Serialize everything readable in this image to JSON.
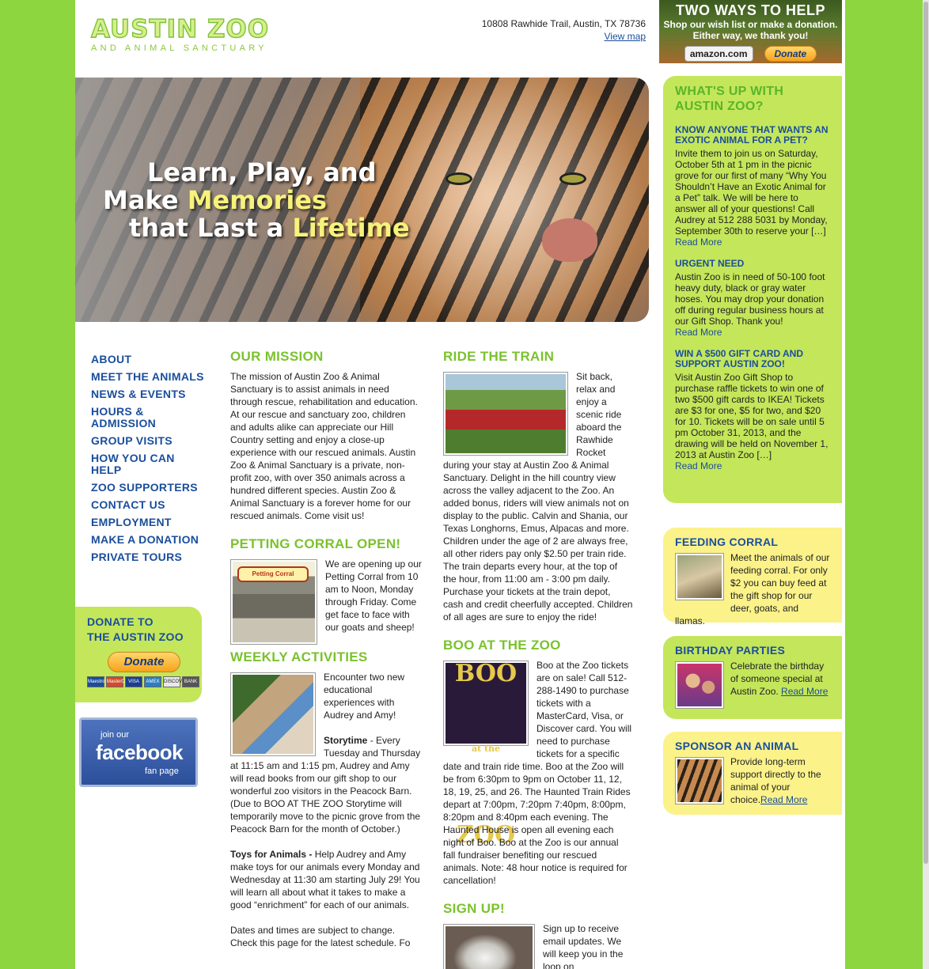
{
  "header": {
    "logo_name": "AUSTIN ZOO",
    "logo_sub": "AND ANIMAL SANCTUARY",
    "address": "10808 Rawhide Trail, Austin, TX 78736",
    "map_link": "View map"
  },
  "help": {
    "title": "TWO WAYS TO HELP",
    "sub1": "Shop our wish list or make a donation.",
    "sub2": "Either way, we thank you!",
    "amazon": "amazon.com",
    "donate": "Donate"
  },
  "hero": {
    "line1": "Learn, Play, and",
    "line2a": "Make ",
    "line2b": "Memories",
    "line3a": "that Last a ",
    "line3b": "Lifetime"
  },
  "nav": [
    "ABOUT",
    "MEET THE ANIMALS",
    "NEWS & EVENTS",
    "HOURS & ADMISSION",
    "GROUP VISITS",
    "HOW YOU CAN HELP",
    "ZOO SUPPORTERS",
    "CONTACT US",
    "EMPLOYMENT",
    "MAKE A DONATION",
    "PRIVATE TOURS"
  ],
  "donate_box": {
    "title1": "DONATE TO",
    "title2": "THE AUSTIN ZOO",
    "button": "Donate",
    "cards": [
      "Maestro",
      "MasterCard",
      "VISA",
      "AMEX",
      "DISCOVER",
      "BANK"
    ]
  },
  "facebook": {
    "join": "join our",
    "name": "facebook",
    "page": "fan page"
  },
  "mission": {
    "title": "OUR MISSION",
    "text": "The mission of Austin Zoo & Animal Sanctuary is to assist animals in need through rescue, rehabilitation and education. At our rescue and sanctuary zoo, children and adults alike can appreciate our Hill Country setting and enjoy a close-up experience with our rescued animals. Austin Zoo & Animal Sanctuary is a private, non-profit zoo, with over 350 animals across a hundred different species. Austin Zoo & Animal Sanctuary is a forever home for our rescued animals. Come visit us!"
  },
  "petting": {
    "title": "PETTING CORRAL OPEN!",
    "sign": "Petting Corral",
    "text": "We are opening up our Petting Corral from 10 am to Noon, Monday through Friday. Come get face to face with our goats and sheep!"
  },
  "weekly": {
    "title": "WEEKLY ACTIVITIES",
    "intro": "Encounter two new educational experiences with Audrey and Amy!",
    "story_label": "Storytime",
    "story_text": " - Every Tuesday and Thursday at 11:15 am and 1:15 pm, Audrey and Amy will read books from our gift shop to our wonderful zoo visitors in the Peacock Barn. (Due to BOO AT THE ZOO Storytime will temporarily move to the picnic grove from the Peacock Barn for the month of October.)",
    "toys_label": "Toys for Animals -",
    "toys_text": " Help Audrey and Amy make toys for our animals every Monday and Wednesday at 11:30 am starting July 29! You will learn all about what it takes to make a good “enrichment” for each of our animals.",
    "dates": "Dates and times are subject to change. Check this page for the latest schedule. Fo"
  },
  "train": {
    "title": "RIDE THE TRAIN",
    "text": "Sit back, relax and enjoy a scenic ride aboard the Rawhide Rocket during your stay at Austin Zoo & Animal Sanctuary. Delight in the hill country view across the valley adjacent to the Zoo. An added bonus, riders will view animals not on display to the public. Calvin and Shania, our Texas Longhorns, Emus, Alpacas and more. Children under the age of 2 are always free, all other riders pay only $2.50 per train ride. The train departs every hour, at the top of the hour, from 11:00 am - 3:00 pm daily. Purchase your tickets at the train depot, cash and credit cheerfully accepted. Children of all ages are sure to enjoy the ride!"
  },
  "boo": {
    "title": "BOO AT THE ZOO",
    "logo1": "BOO",
    "logo2": "at the",
    "logo3": "ZOO",
    "text": "Boo at the Zoo tickets are on sale! Call 512-288-1490 to purchase tickets with a MasterCard, Visa, or Discover card. You will need to purchase tickets for a specific date and train ride time. Boo at the Zoo will be from 6:30pm to 9pm on October 11, 12, 18, 19, 25, and 26. The Haunted Train Rides depart at 7:00pm, 7:20pm 7:40pm, 8:00pm, 8:20pm and 8:40pm each evening. The Haunted House is open all evening each night of Boo. Boo at the Zoo is our annual fall fundraiser benefiting our rescued animals. Note: 48 hour notice is required for cancellation!"
  },
  "signup": {
    "title": "SIGN UP!",
    "text": "Sign up to receive email updates. We will keep you in the loop on"
  },
  "whatsup": {
    "title": "WHAT'S UP WITH AUSTIN ZOO?",
    "items": [
      {
        "heading": "KNOW ANYONE THAT WANTS AN EXOTIC ANIMAL FOR A PET?",
        "text": "Invite them to join us on Saturday, October 5th at 1 pm in the picnic grove for our first of many “Why You Shouldn’t Have an Exotic Animal for a Pet” talk. We will be here to answer all of your questions! Call Audrey at 512 288 5031 by Monday, September 30th to reserve your […]",
        "link": "Read More"
      },
      {
        "heading": "URGENT NEED",
        "text": "Austin Zoo is in need of 50-100 foot heavy duty, black or gray water hoses. You may drop your donation off during regular business hours at our Gift Shop. Thank you!",
        "link": "Read More"
      },
      {
        "heading": "WIN A $500 GIFT CARD AND SUPPORT AUSTIN ZOO!",
        "text": "Visit Austin Zoo Gift Shop to purchase raffle tickets to win one of two $500 gift cards to IKEA! Tickets are $3 for one, $5 for two, and $20 for 10. Tickets will be on sale until 5 pm October 31, 2013, and the drawing will be held on November 1, 2013 at Austin Zoo […]",
        "link": "Read More"
      }
    ]
  },
  "feeding": {
    "title": "FEEDING CORRAL",
    "text": "Meet the animals of our feeding corral. For only $2 you can buy feed at the gift shop for our deer, goats, and llamas."
  },
  "birthday": {
    "title": "BIRTHDAY PARTIES",
    "text": "Celebrate the birthday of someone special at Austin Zoo. ",
    "link": "Read More"
  },
  "sponsor": {
    "title": "SPONSOR AN ANIMAL",
    "text": "Provide long-term support directly to the animal of your choice.",
    "link": "Read More"
  }
}
